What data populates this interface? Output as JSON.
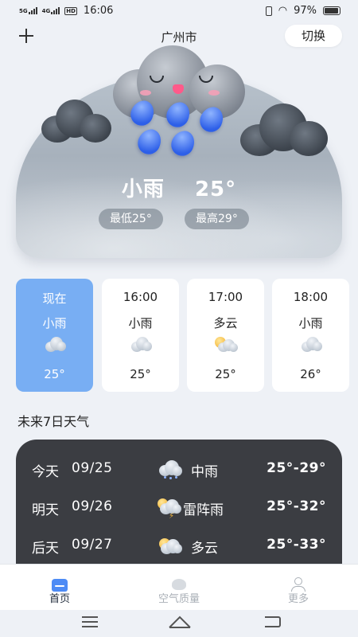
{
  "status_bar": {
    "signal1": "5G",
    "signal2": "4G",
    "hd": "HD",
    "time": "16:06",
    "battery": "97%"
  },
  "header": {
    "city": "广州市",
    "switch_label": "切换"
  },
  "current": {
    "condition": "小雨",
    "temp": "25°",
    "low": "最低25°",
    "high": "最高29°"
  },
  "hourly": [
    {
      "time": "现在",
      "condition": "小雨",
      "temp": "25°",
      "icon": "cloud-rain-icon",
      "active": true
    },
    {
      "time": "16:00",
      "condition": "小雨",
      "temp": "25°",
      "icon": "cloud-rain-icon",
      "active": false
    },
    {
      "time": "17:00",
      "condition": "多云",
      "temp": "25°",
      "icon": "partly-cloudy-icon",
      "active": false
    },
    {
      "time": "18:00",
      "condition": "小雨",
      "temp": "26°",
      "icon": "cloud-rain-icon",
      "active": false
    }
  ],
  "forecast_title": "未来7日天气",
  "forecast": [
    {
      "day": "今天",
      "date": "09/25",
      "condition": "中雨",
      "range": "25°-29°",
      "icon": "rain-cloud-icon"
    },
    {
      "day": "明天",
      "date": "09/26",
      "condition": "雷阵雨",
      "range": "25°-32°",
      "icon": "thunderstorm-icon"
    },
    {
      "day": "后天",
      "date": "09/27",
      "condition": "多云",
      "range": "25°-33°",
      "icon": "partly-cloudy-icon"
    }
  ],
  "nav": {
    "home": "首页",
    "air": "空气质量",
    "more": "更多"
  },
  "colors": {
    "accent": "#78aef3",
    "nav_active": "#4d8bf5",
    "panel": "#3b3d42"
  }
}
